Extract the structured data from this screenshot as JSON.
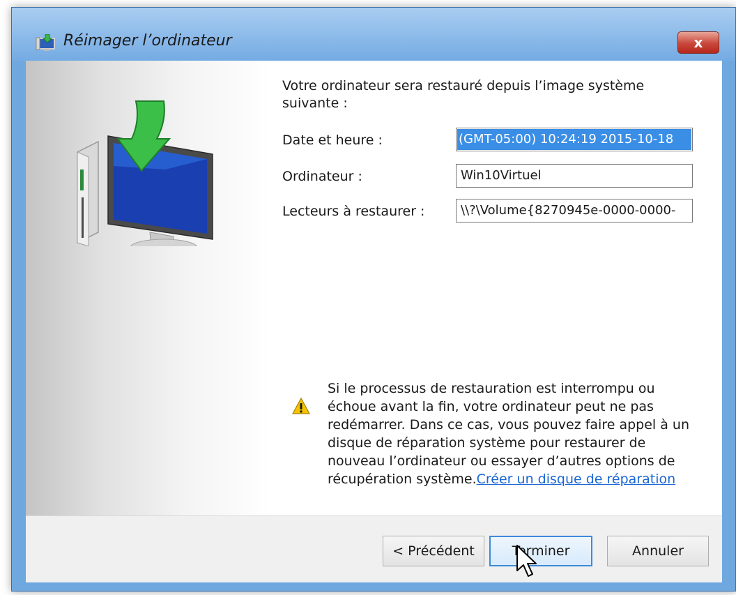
{
  "window": {
    "title": "Réimager l’ordinateur",
    "close_glyph": "x"
  },
  "content": {
    "intro": "Votre ordinateur sera restauré depuis l’image système suivante :",
    "rows": [
      {
        "label": "Date et heure :",
        "value": "2015-10-18 10:24:19 (GMT-05:00)"
      },
      {
        "label": "Ordinateur :",
        "value": "Win10Virtuel"
      },
      {
        "label": "Lecteurs à restaurer :",
        "value": "\\\\?\\Volume{8270945e-0000-0000-"
      }
    ]
  },
  "warning": {
    "text": "Si le processus de restauration est interrompu ou échoue avant la fin, votre ordinateur peut ne pas redémarrer. Dans ce cas, vous pouvez faire appel à un disque de réparation système pour restaurer de nouveau l’ordinateur ou essayer d’autres options de récupération système.",
    "link": "Créer un disque de réparation"
  },
  "buttons": {
    "previous": "< Précédent",
    "finish": "Terminer",
    "cancel": "Annuler"
  },
  "icons": {
    "title": "system-restore-icon",
    "illustration": "monitor-restore-icon",
    "warning": "warning-triangle-icon",
    "cursor": "mouse-pointer-icon"
  },
  "colors": {
    "titlebar": "#74abe3",
    "selection": "#3a8ee6",
    "link": "#1a66d4",
    "close": "#c9473b",
    "default_button_border": "#3d8ad8"
  }
}
